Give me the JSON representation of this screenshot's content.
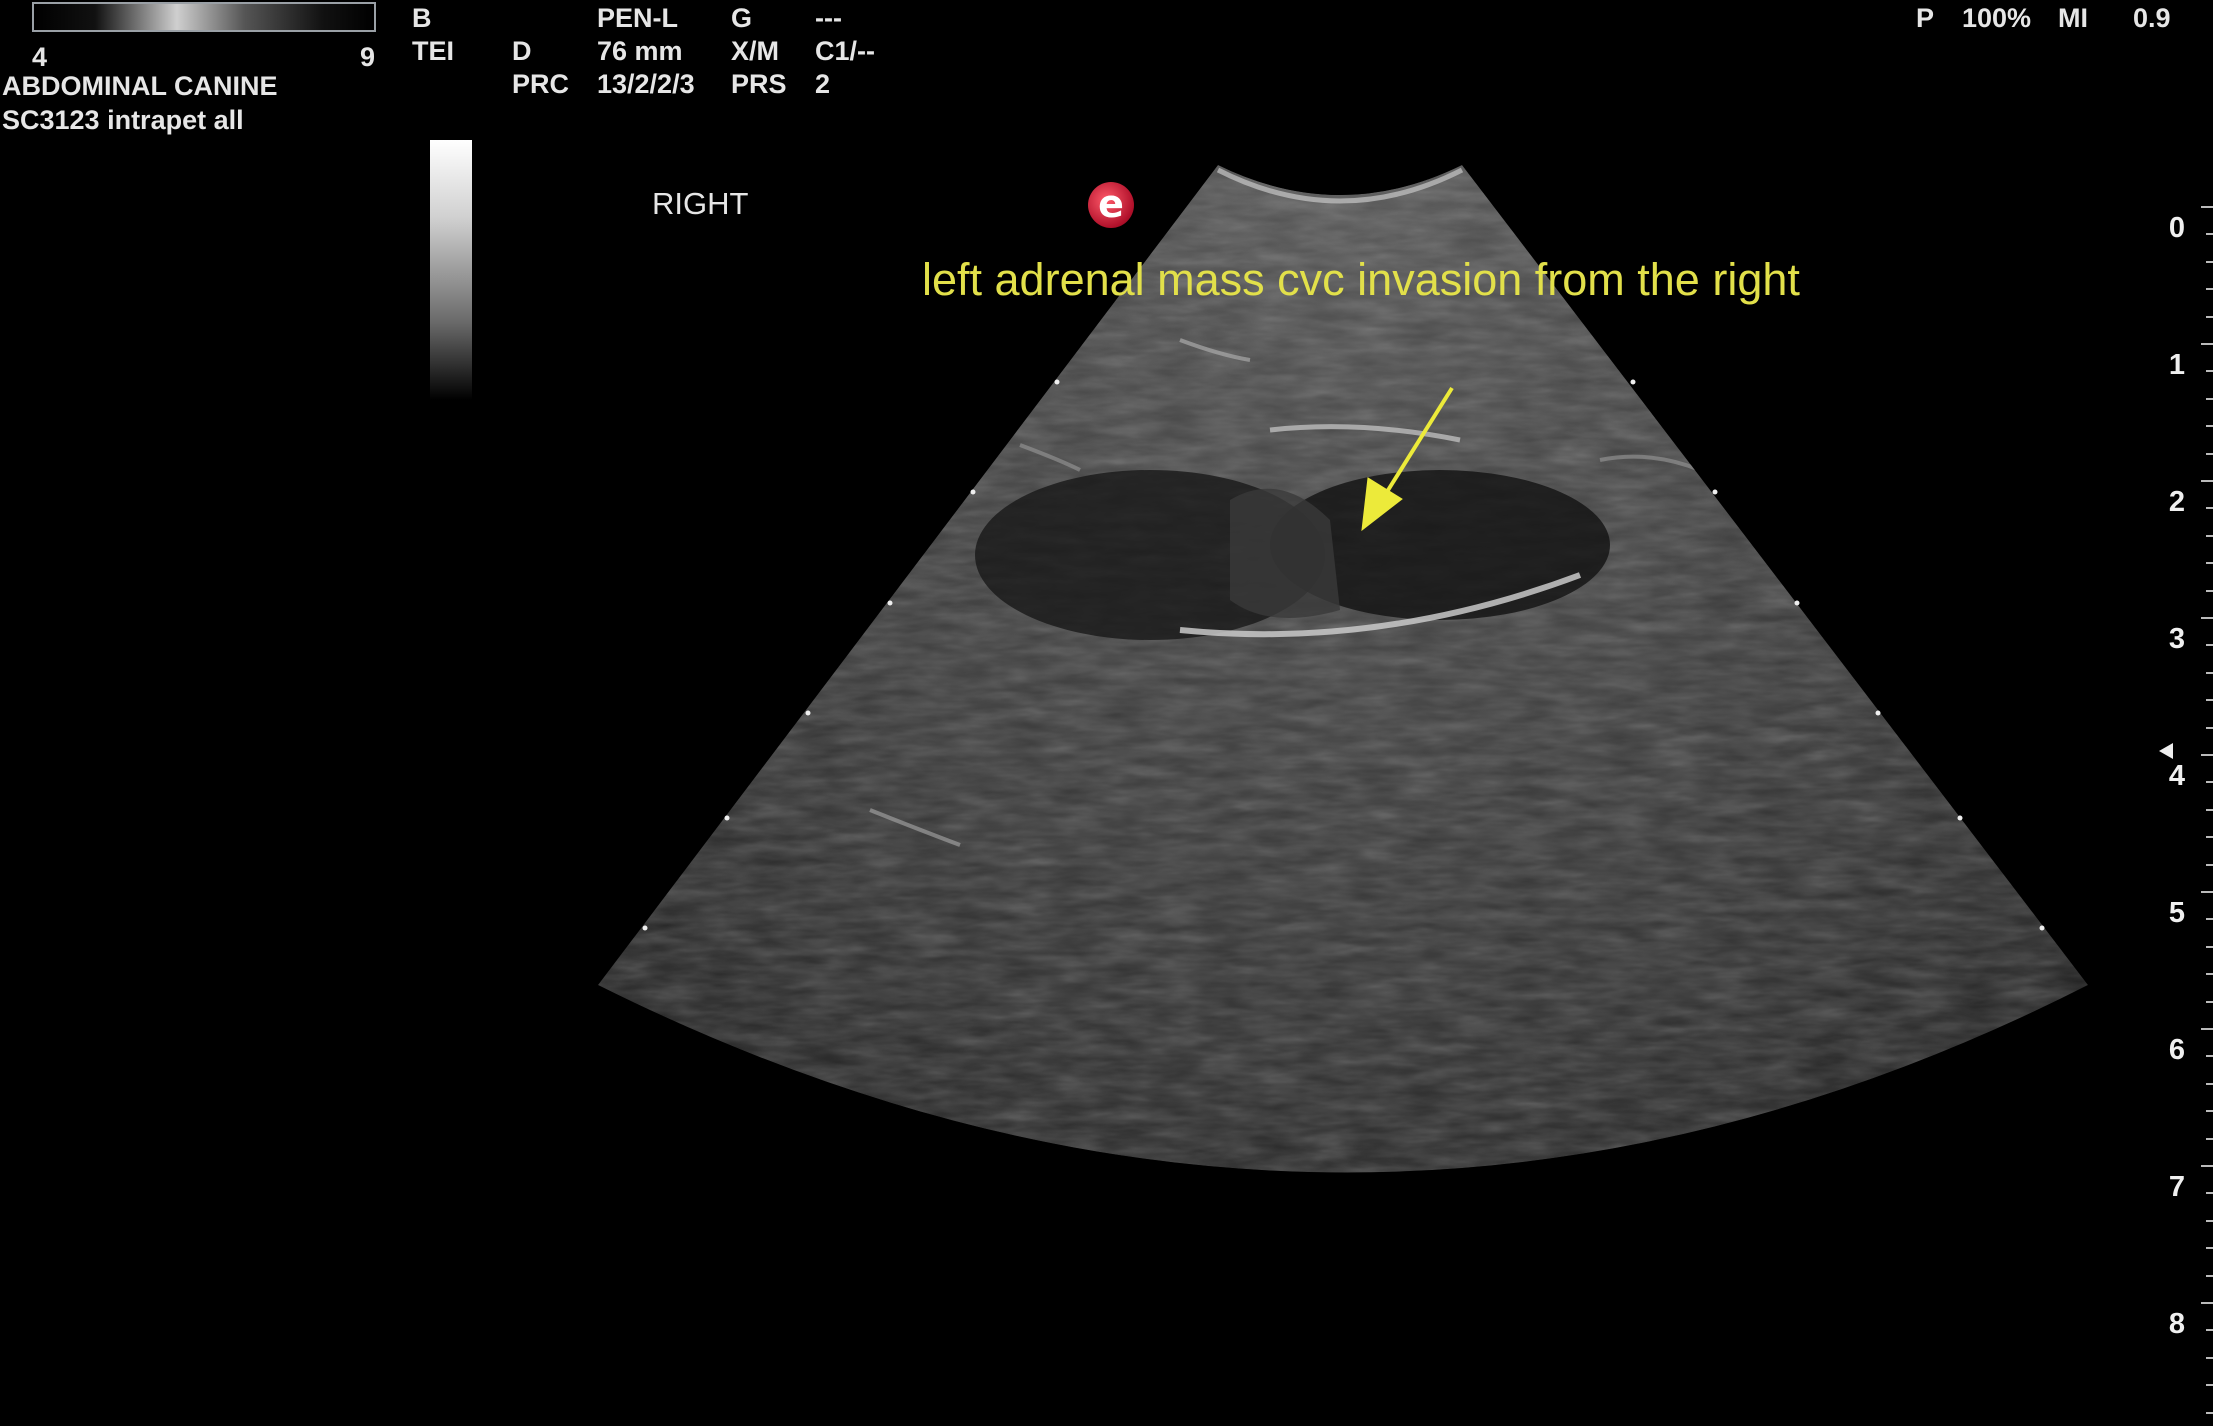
{
  "header": {
    "scale_left": "4",
    "scale_right": "9",
    "preset": "ABDOMINAL CANINE",
    "probe_line": "SC3123   intrapet all",
    "col1": [
      "B",
      "TEI"
    ],
    "col2_label": [
      "D",
      "PRC"
    ],
    "col3": [
      "PEN-L",
      "76 mm",
      "13/2/2/3"
    ],
    "col4": [
      "G",
      "X/M",
      "PRS"
    ],
    "col5": [
      "---",
      "C1/--",
      "2"
    ],
    "power_label": "P",
    "power_value": "100%",
    "mi_label": "MI",
    "mi_value": "0.9"
  },
  "image": {
    "orientation": "RIGHT",
    "annotation": "left adrenal mass cvc invasion from the right",
    "logo_letter": "e",
    "annotation_color": "#e2e04a"
  },
  "depth_scale": {
    "labels": [
      "0",
      "1",
      "2",
      "3",
      "4",
      "5",
      "6",
      "7",
      "8"
    ],
    "unit": "cm"
  }
}
